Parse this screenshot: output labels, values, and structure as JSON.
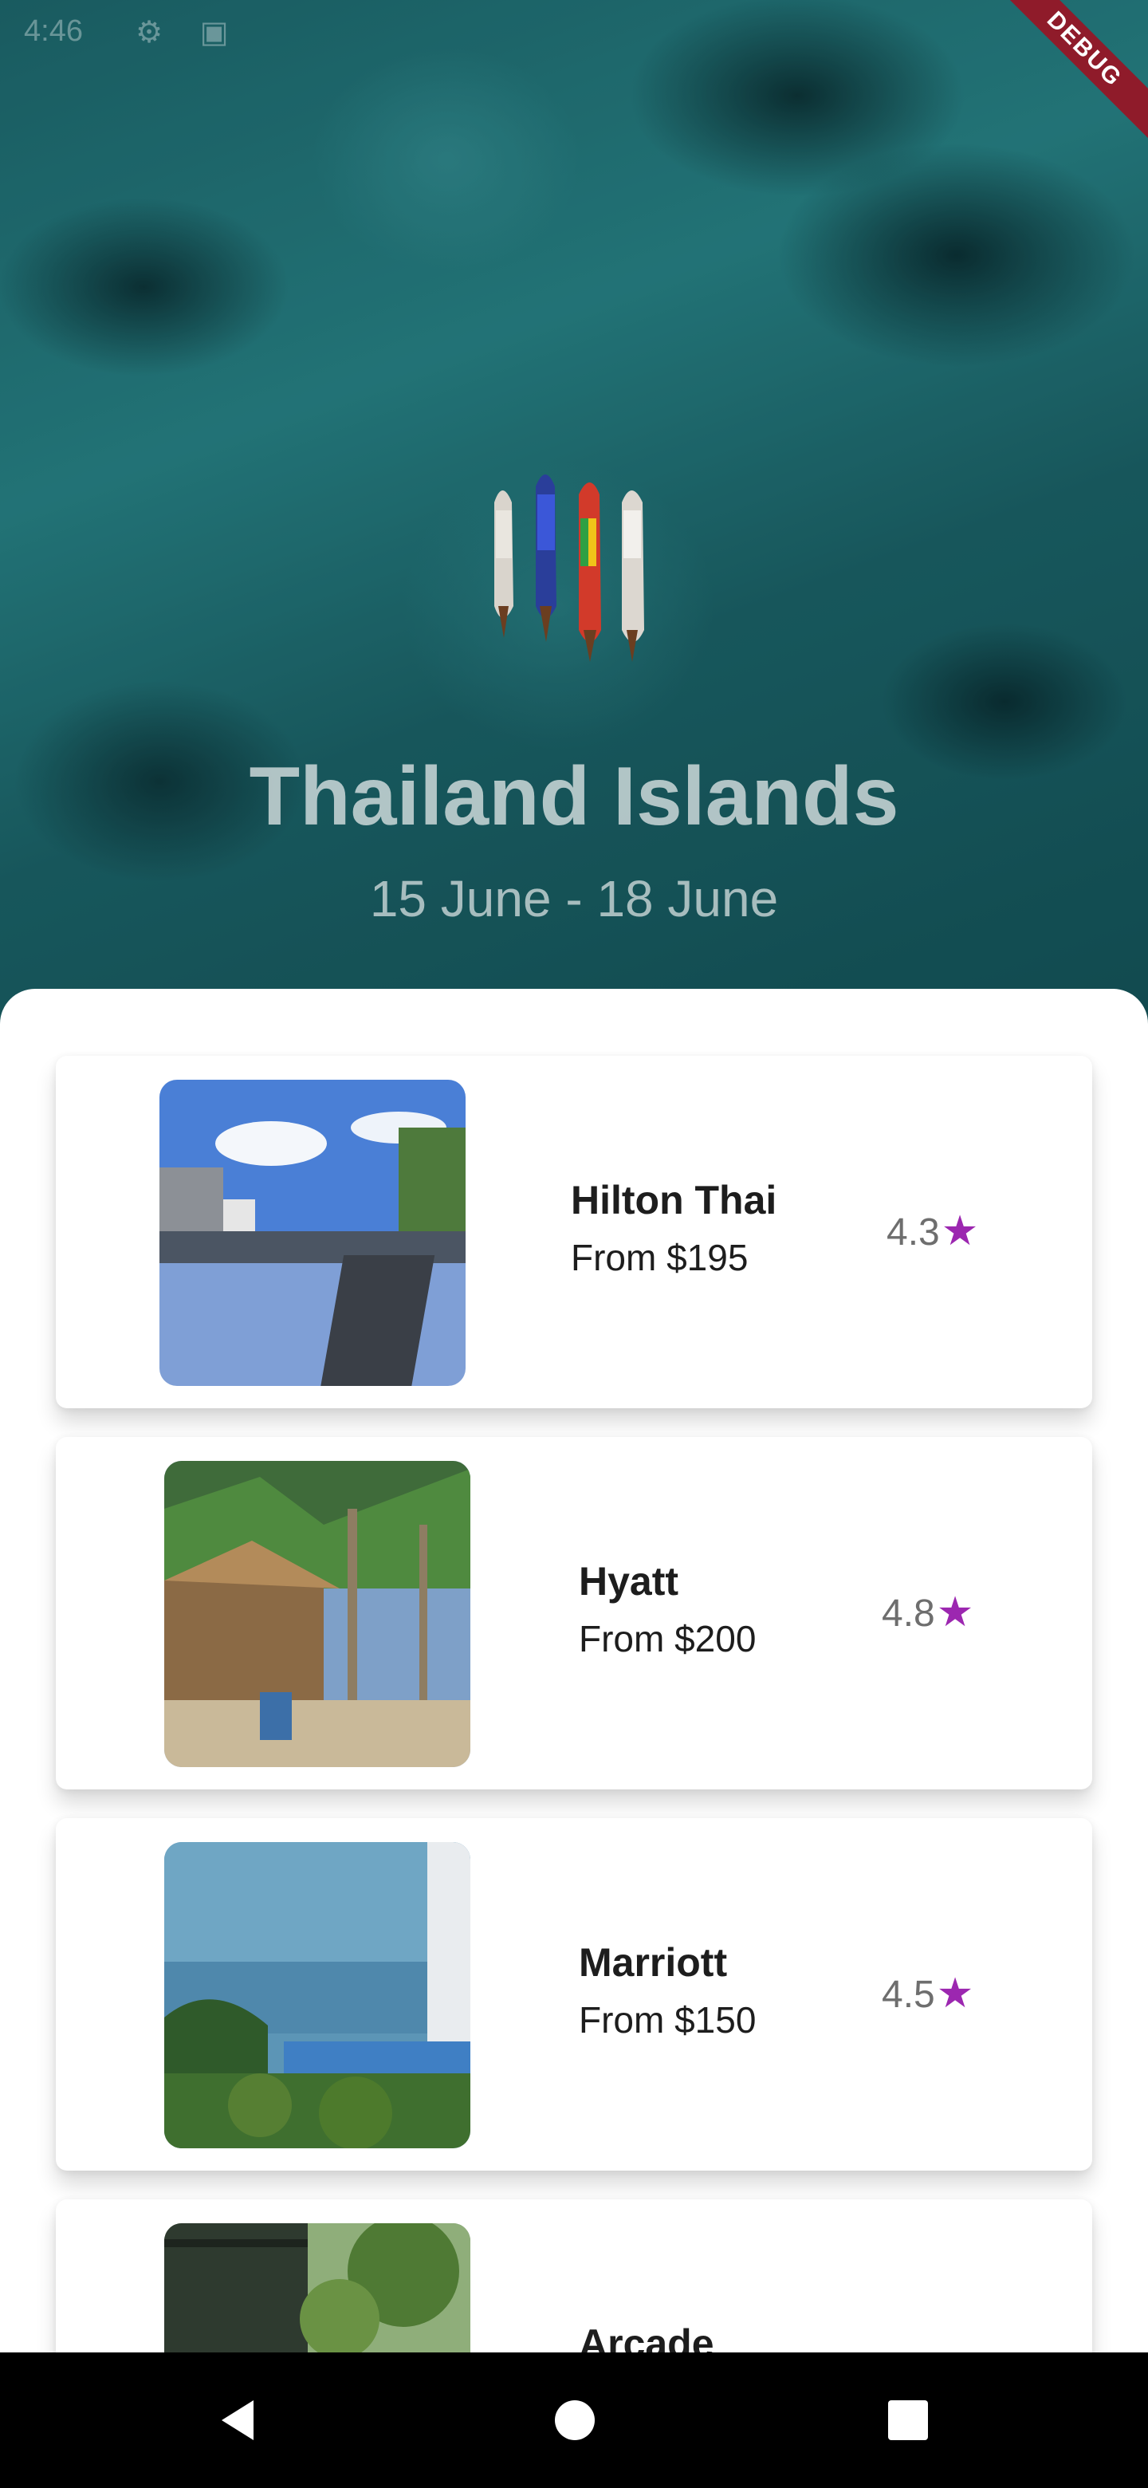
{
  "status_bar": {
    "time": "4:46"
  },
  "debug_banner": "DEBUG",
  "hero": {
    "title": "Thailand Islands",
    "dates": "15 June - 18 June"
  },
  "hotels": [
    {
      "name": "Hilton Thai",
      "price": "From $195",
      "rating": "4.3",
      "image": "pool-resort-photo"
    },
    {
      "name": "Hyatt",
      "price": "From $200",
      "rating": "4.8",
      "image": "beach-hut-palms-photo"
    },
    {
      "name": "Marriott",
      "price": "From $150",
      "rating": "4.5",
      "image": "sea-view-pool-photo"
    },
    {
      "name": "Arcade",
      "price": "",
      "rating": "",
      "image": "garden-terrace-photo"
    }
  ],
  "icons": {
    "rating": "star-icon",
    "nav": [
      "back-icon",
      "home-icon",
      "recents-icon"
    ]
  },
  "colors": {
    "accent": "#9c27b0",
    "debug": "#8f1b2a"
  }
}
